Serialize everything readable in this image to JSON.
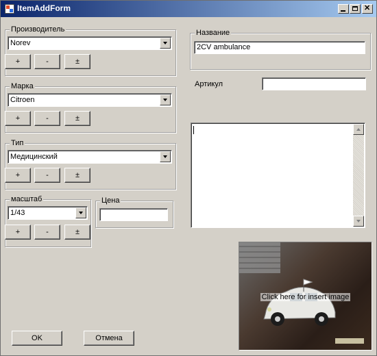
{
  "window": {
    "title": "ItemAddForm"
  },
  "manufacturer": {
    "legend": "Производитель",
    "value": "Norev"
  },
  "brand": {
    "legend": "Марка",
    "value": "Citroen"
  },
  "type": {
    "legend": "Тип",
    "value": "Медицинский"
  },
  "scale": {
    "legend": "масштаб",
    "value": "1/43"
  },
  "price": {
    "legend": "Цена",
    "value": ""
  },
  "name": {
    "legend": "Название",
    "value": "2CV ambulance"
  },
  "article": {
    "label": "Артикул",
    "value": ""
  },
  "description": {
    "value": ""
  },
  "buttons": {
    "add": "+",
    "remove": "-",
    "edit": "±",
    "ok": "OK",
    "cancel": "Отмена"
  },
  "image": {
    "hint": "Click here for insert image"
  }
}
